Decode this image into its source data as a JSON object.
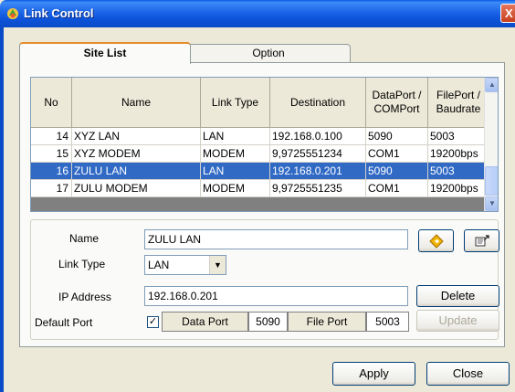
{
  "window": {
    "title": "Link Control",
    "close_glyph": "X"
  },
  "tabs": [
    {
      "label": "Site List",
      "active": true
    },
    {
      "label": "Option",
      "active": false
    }
  ],
  "grid": {
    "columns": [
      "No",
      "Name",
      "Link Type",
      "Destination",
      "DataPort / COMPort",
      "FilePort / Baudrate"
    ],
    "rows": [
      {
        "no": "14",
        "name": "XYZ LAN",
        "type": "LAN",
        "dest": "192.168.0.100",
        "port": "5090",
        "file": "5003"
      },
      {
        "no": "15",
        "name": "XYZ MODEM",
        "type": "MODEM",
        "dest": "9,9725551234",
        "port": "COM1",
        "file": "19200bps"
      },
      {
        "no": "16",
        "name": "ZULU LAN",
        "type": "LAN",
        "dest": "192.168.0.201",
        "port": "5090",
        "file": "5003"
      },
      {
        "no": "17",
        "name": "ZULU MODEM",
        "type": "MODEM",
        "dest": "9,9725551235",
        "port": "COM1",
        "file": "19200bps"
      }
    ],
    "selected_row": "16"
  },
  "details": {
    "name_label": "Name",
    "name_value": "ZULU LAN",
    "link_type_label": "Link Type",
    "link_type_value": "LAN",
    "ip_label": "IP Address",
    "ip_value": "192.168.0.201",
    "default_port_label": "Default Port",
    "checkbox_mark": "✓",
    "data_port_label": "Data Port",
    "data_port_value": "5090",
    "file_port_label": "File Port",
    "file_port_value": "5003"
  },
  "buttons": {
    "delete": "Delete",
    "update": "Update",
    "apply": "Apply",
    "close": "Close"
  },
  "icons": {
    "title_icon": "app-icon",
    "fav_icon": "diamond-icon",
    "folder_icon": "folder-icon"
  },
  "colors": {
    "title_bar": "#0a4cc8",
    "selection": "#316ac5",
    "active_tab_accent": "#e68b2c"
  }
}
